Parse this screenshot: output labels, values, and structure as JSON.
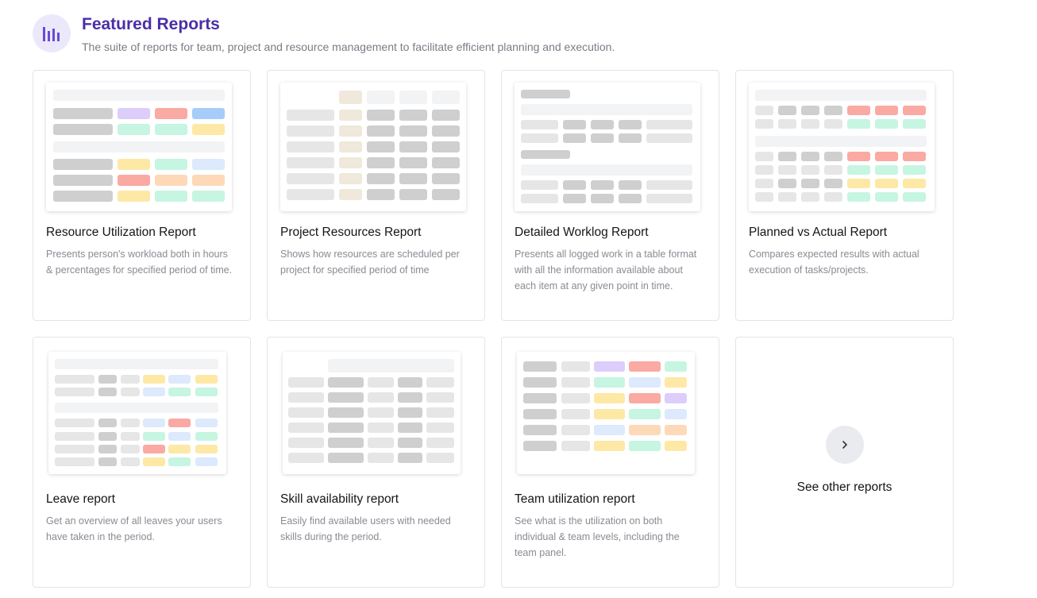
{
  "header": {
    "title": "Featured Reports",
    "subtitle": "The suite of reports for team, project and resource management to facilitate efficient planning and execution.",
    "icon": "bar-chart-icon"
  },
  "palette": {
    "gray_light": "#f2f3f5",
    "gray_mid": "#e6e6e6",
    "gray_dark": "#cfcfcf",
    "beige": "#efe8db",
    "purple": "#dccdfb",
    "red": "#faa9a3",
    "blue": "#a6ccfa",
    "blue_light": "#dde9fc",
    "green": "#c6f5e2",
    "yellow": "#fde8a6",
    "orange": "#fdd9b8"
  },
  "reports": [
    {
      "title": "Resource Utilization Report",
      "description": "Presents person's workload both in hours & percentages for specified period of time."
    },
    {
      "title": "Project Resources Report",
      "description": "Shows how resources are scheduled per project for specified period of time"
    },
    {
      "title": "Detailed Worklog Report",
      "description": "Presents all logged work in a table format with all the information available about each item at any given point in time."
    },
    {
      "title": "Planned vs Actual Report",
      "description": "Compares expected results with actual execution of tasks/projects."
    },
    {
      "title": "Leave report",
      "description": "Get an overview of all leaves your users have taken in the period."
    },
    {
      "title": "Skill availability report",
      "description": "Easily find available users with needed skills during the period."
    },
    {
      "title": "Team utilization report",
      "description": "See what is the utilization on both individual & team levels, including the team panel."
    }
  ],
  "see_other": {
    "label": "See other reports",
    "icon": "chevron-right-icon"
  }
}
